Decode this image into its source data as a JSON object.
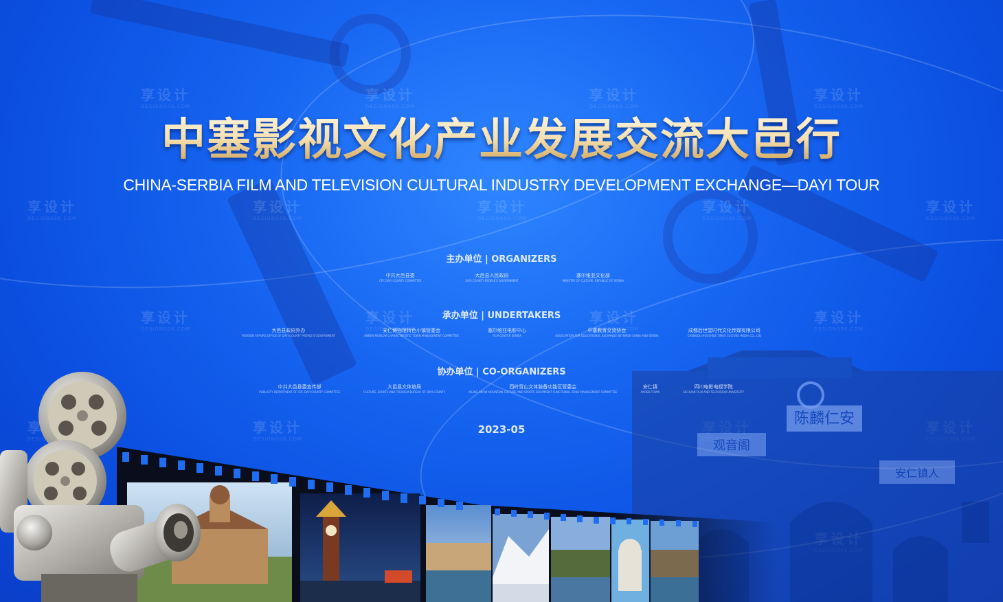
{
  "title_cn": "中塞影视文化产业发展交流大邑行",
  "title_en": "CHINA-SERBIA FILM AND TELEVISION CULTURAL INDUSTRY DEVELOPMENT EXCHANGE—DAYI TOUR",
  "watermark": {
    "cn": "享设计",
    "en": "DESIGN006.COM"
  },
  "organizers": {
    "heading": "主办单位 | ORGANIZERS",
    "items": [
      {
        "cn": "中共大邑县委",
        "en": "CPC DAYI COUNTY COMMITTEE"
      },
      {
        "cn": "大邑县人民政府",
        "en": "DAYI COUNTY PEOPLE'S GOVERNMENT"
      },
      {
        "cn": "塞尔维亚文化部",
        "en": "MINISTRY OF CULTURE, REPUBLIC OF SERBIA"
      }
    ]
  },
  "undertakers": {
    "heading": "承办单位 | UNDERTAKERS",
    "items": [
      {
        "cn": "大邑县政府外办",
        "en": "FOREIGN AFFAIRS OFFICE OF DAYI COUNTY PEOPLE'S GOVERNMENT"
      },
      {
        "cn": "安仁博物馆特色小镇管委会",
        "en": "ANREN MUSEUM CHARACTERISTIC TOWN MANAGEMENT COMMITTEE"
      },
      {
        "cn": "塞尔维亚电影中心",
        "en": "FILM CENTER SERBIA"
      },
      {
        "cn": "中塞教育交流协会",
        "en": "ASSOCIATION FOR EDUCATIONAL EXCHANGE BETWEEN CHINA AND SERBIA"
      },
      {
        "cn": "成都后世堂时代文化传媒有限公司",
        "en": "CHENGDU HOUSHIJIE TIMES CULTURE MEDIA CO., LTD"
      }
    ]
  },
  "co_organizers": {
    "heading": "协办单位 | CO-ORGANIZERS",
    "items": [
      {
        "cn": "中共大邑县委宣传部",
        "en": "PUBLICITY DEPARTMENT OF CPC DAYI COUNTY COMMITTEE"
      },
      {
        "cn": "大邑县文体旅局",
        "en": "CULTURE, SPORTS AND TOURISM BUREAU OF DAYI COUNTY"
      },
      {
        "cn": "西岭雪山文体装备功能区管委会",
        "en": "XILING SNOW MOUNTAIN CULTURE AND SPORTS EQUIPMENT FUNCTIONAL ZONE MANAGEMENT COMMITTEE"
      },
      {
        "cn": "安仁镇",
        "en": "ANREN TOWN"
      },
      {
        "cn": "四川电影电视学院",
        "en": "SICHUAN FILM AND TELEVISION UNIVERSITY"
      }
    ]
  },
  "date": "2023-05",
  "building_signs": [
    "陈麟仁安",
    "观音阁",
    "安仁镇人"
  ],
  "colors": {
    "background": "#1766f2",
    "title_gold": "#f5dfae",
    "film_strip": "#0a0e1c"
  }
}
